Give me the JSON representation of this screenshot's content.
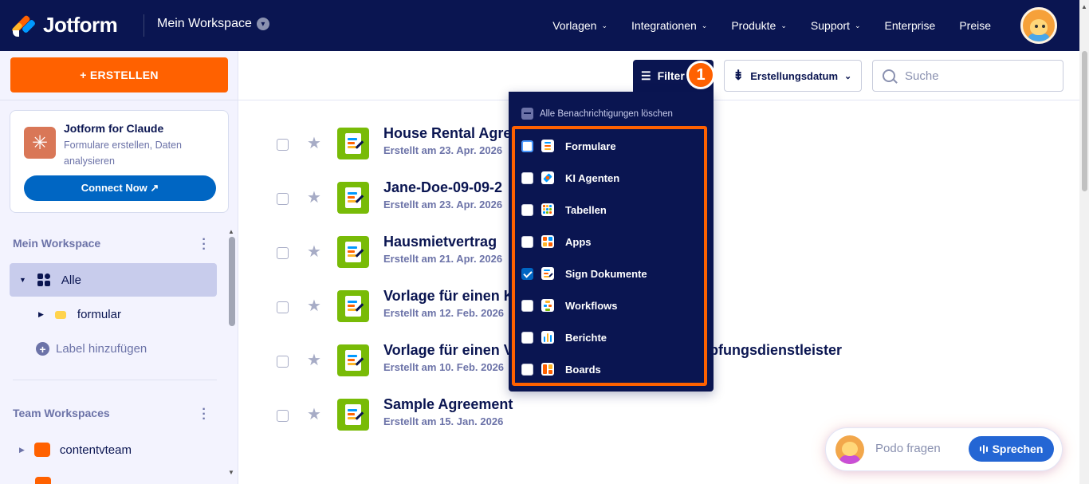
{
  "nav": {
    "logo_text": "Jotform",
    "workspace": "Mein Workspace",
    "menu": [
      {
        "label": "Vorlagen",
        "has_caret": true
      },
      {
        "label": "Integrationen",
        "has_caret": true
      },
      {
        "label": "Produkte",
        "has_caret": true
      },
      {
        "label": "Support",
        "has_caret": true
      },
      {
        "label": "Enterprise",
        "has_caret": false
      },
      {
        "label": "Preise",
        "has_caret": false
      }
    ]
  },
  "sidebar": {
    "create_label": "+ ERSTELLEN",
    "claude_card": {
      "title": "Jotform for Claude",
      "subtitle": "Formulare erstellen, Daten analysieren",
      "button": "Connect Now ↗"
    },
    "workspace_title": "Mein Workspace",
    "all_label": "Alle",
    "folder_label": "formular",
    "add_label": "Label hinzufügen",
    "team_title": "Team Workspaces",
    "team_item": "contentvteam"
  },
  "toolbar": {
    "filter_label": "Filter",
    "badge": "1",
    "sort_label": "Erstellungsdatum",
    "search_placeholder": "Suche"
  },
  "forms": [
    {
      "title": "House Rental Agree",
      "date": "Erstellt am 23. Apr. 2026"
    },
    {
      "title": "Jane-Doe-09-09-2",
      "date": "Erstellt am 23. Apr. 2026"
    },
    {
      "title": "Hausmietvertrag",
      "date": "Erstellt am 21. Apr. 2026"
    },
    {
      "title": "Vorlage für einen K",
      "date": "Erstellt am 12. Feb. 2026"
    },
    {
      "title": "Vorlage für einen V",
      "title_tail": "npfungsdienstleister",
      "date": "Erstellt am 10. Feb. 2026"
    },
    {
      "title": "Sample Agreement",
      "date": "Erstellt am 15. Jan. 2026"
    }
  ],
  "filter_menu": {
    "clear_label": "Alle Benachrichtigungen löschen",
    "options": [
      {
        "label": "Formulare",
        "checked": false,
        "focused": true
      },
      {
        "label": "KI Agenten",
        "checked": false
      },
      {
        "label": "Tabellen",
        "checked": false
      },
      {
        "label": "Apps",
        "checked": false
      },
      {
        "label": "Sign Dokumente",
        "checked": true
      },
      {
        "label": "Workflows",
        "checked": false
      },
      {
        "label": "Berichte",
        "checked": false
      },
      {
        "label": "Boards",
        "checked": false
      }
    ]
  },
  "podo": {
    "placeholder": "Podo fragen",
    "button": "Sprechen"
  },
  "colors": {
    "nav_bg": "#0a1551",
    "accent_orange": "#ff6100",
    "brand_blue": "#0066c3",
    "form_icon_green": "#78bb07"
  }
}
